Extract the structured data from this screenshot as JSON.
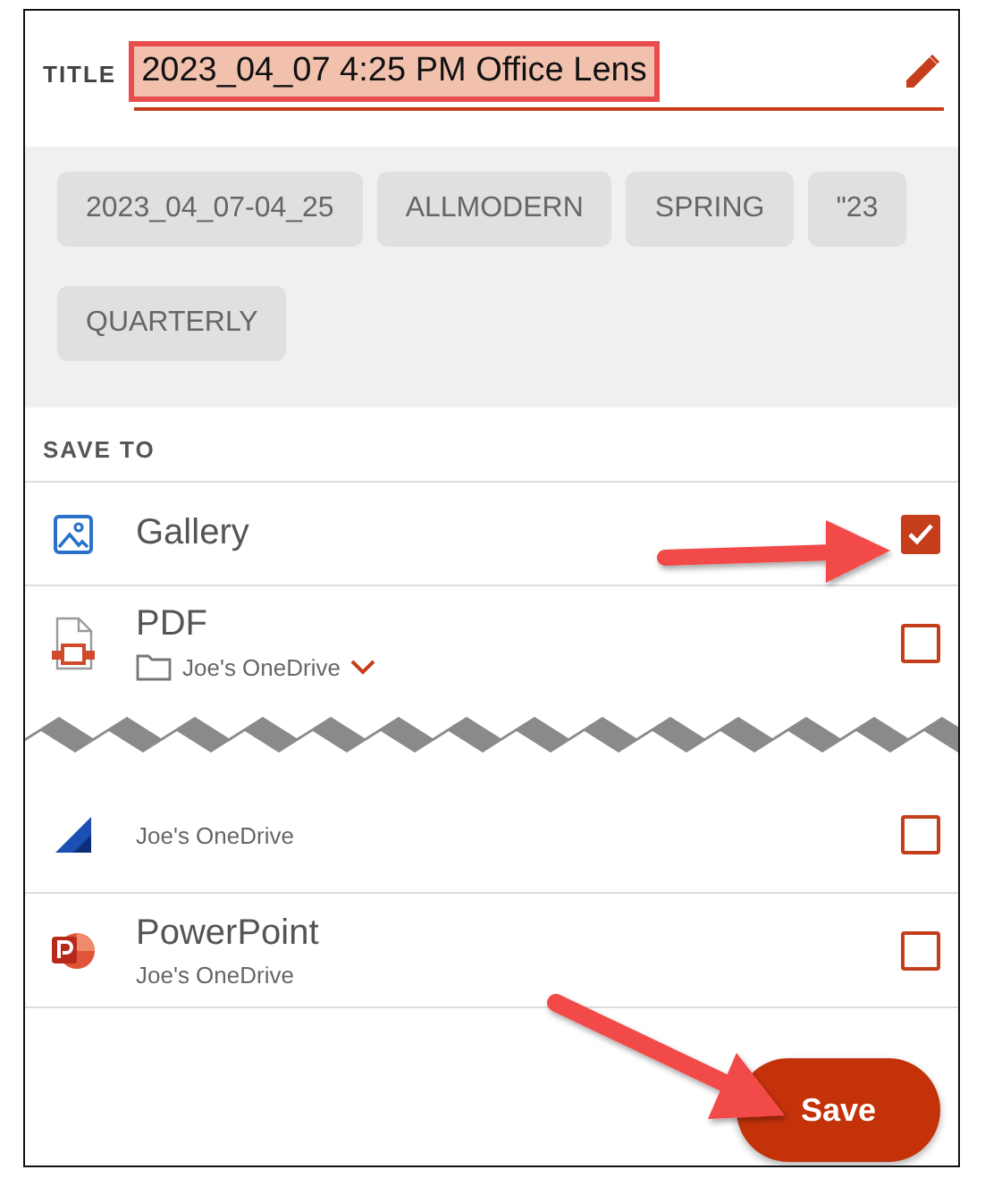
{
  "title": {
    "label": "TITLE",
    "value": "2023_04_07 4:25 PM Office Lens",
    "highlighted": true
  },
  "tags": [
    "2023_04_07-04_25",
    "ALLMODERN",
    "SPRING",
    "\"23",
    "QUARTERLY"
  ],
  "save_to": {
    "label": "SAVE TO",
    "destinations": [
      {
        "kind": "gallery",
        "name": "Gallery",
        "checked": true
      },
      {
        "kind": "pdf",
        "name": "PDF",
        "location": "Joe's OneDrive",
        "dropdown": true,
        "checked": false
      },
      {
        "kind": "document",
        "location": "Joe's OneDrive",
        "checked": false
      },
      {
        "kind": "powerpoint",
        "name": "PowerPoint",
        "location": "Joe's OneDrive",
        "checked": false
      }
    ]
  },
  "save_button": "Save"
}
